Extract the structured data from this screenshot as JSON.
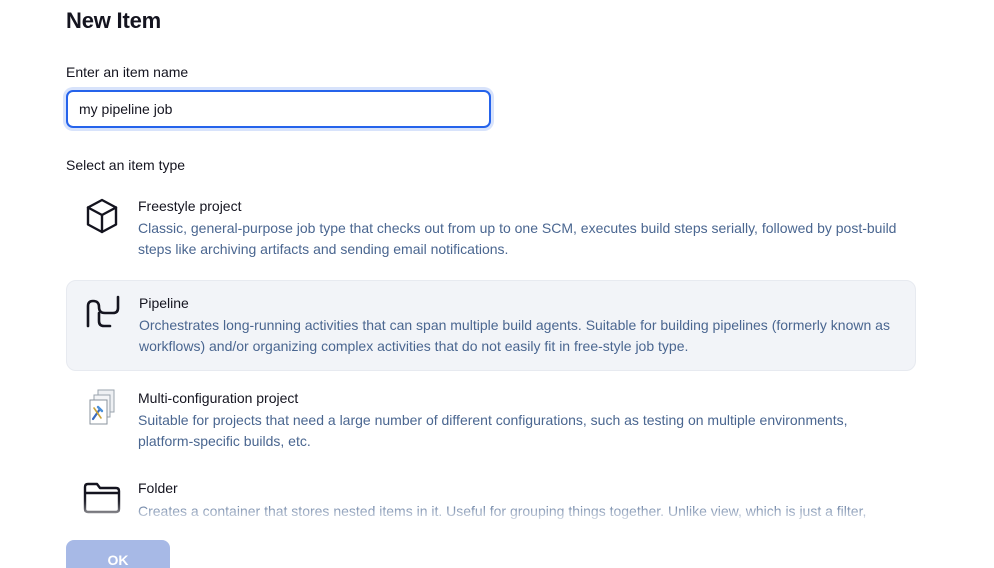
{
  "page": {
    "title": "New Item",
    "name_label": "Enter an item name",
    "name_value": "my pipeline job",
    "type_label": "Select an item type"
  },
  "items": [
    {
      "title": "Freestyle project",
      "description": "Classic, general-purpose job type that checks out from up to one SCM, executes build steps serially, followed by post-build steps like archiving artifacts and sending email notifications.",
      "icon": "cube-icon",
      "selected": false
    },
    {
      "title": "Pipeline",
      "description": "Orchestrates long-running activities that can span multiple build agents. Suitable for building pipelines (formerly known as workflows) and/or organizing complex activities that do not easily fit in free-style job type.",
      "icon": "pipeline-icon",
      "selected": true
    },
    {
      "title": "Multi-configuration project",
      "description": "Suitable for projects that need a large number of different configurations, such as testing on multiple environments, platform-specific builds, etc.",
      "icon": "multi-config-icon",
      "selected": false
    },
    {
      "title": "Folder",
      "description": "Creates a container that stores nested items in it. Useful for grouping things together. Unlike view, which is just a filter,",
      "icon": "folder-icon",
      "selected": false
    }
  ],
  "footer": {
    "ok_label": "OK"
  },
  "colors": {
    "accent": "#2563eb",
    "description_text": "#4a6690",
    "selected_bg": "#f2f4f8",
    "ok_button_disabled": "#a7b9e6"
  }
}
